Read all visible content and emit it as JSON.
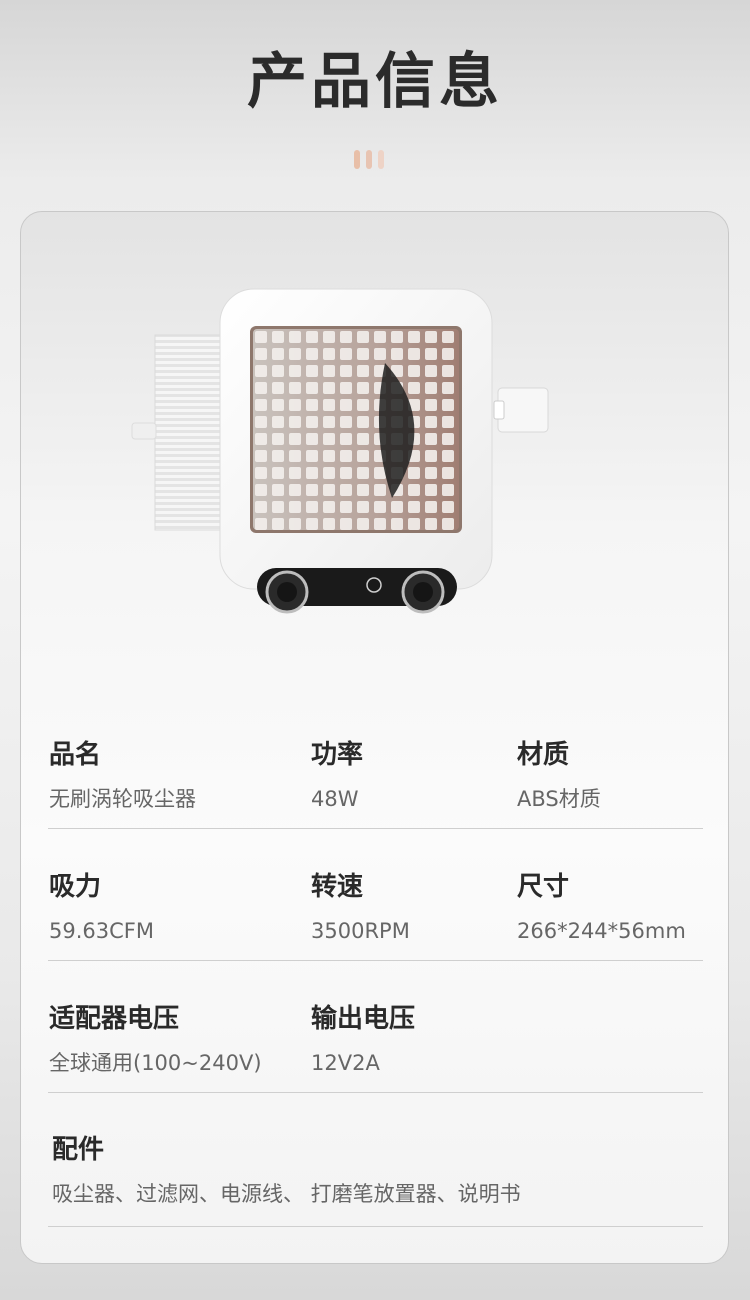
{
  "header": {
    "title": "产品信息"
  },
  "colors": {
    "deco": [
      "#e8bfa8",
      "#e8c4b2",
      "#eed3c6"
    ],
    "accent": "#c98a6c"
  },
  "product": {
    "image": "robot-vacuum-fan-image"
  },
  "specs": {
    "row1": [
      {
        "label": "品名",
        "value": "无刷涡轮吸尘器"
      },
      {
        "label": "功率",
        "value": "48W"
      },
      {
        "label": "材质",
        "value": "ABS材质"
      }
    ],
    "row2": [
      {
        "label": "吸力",
        "value": "59.63CFM"
      },
      {
        "label": "转速",
        "value": "3500RPM"
      },
      {
        "label": "尺寸",
        "value": "266*244*56mm"
      }
    ],
    "row3": [
      {
        "label": "适配器电压",
        "value": "全球通用(100~240V)"
      },
      {
        "label": "输出电压",
        "value": "12V2A"
      }
    ],
    "accessories": {
      "label": "配件",
      "value": "吸尘器、过滤网、电源线、 打磨笔放置器、说明书"
    }
  }
}
